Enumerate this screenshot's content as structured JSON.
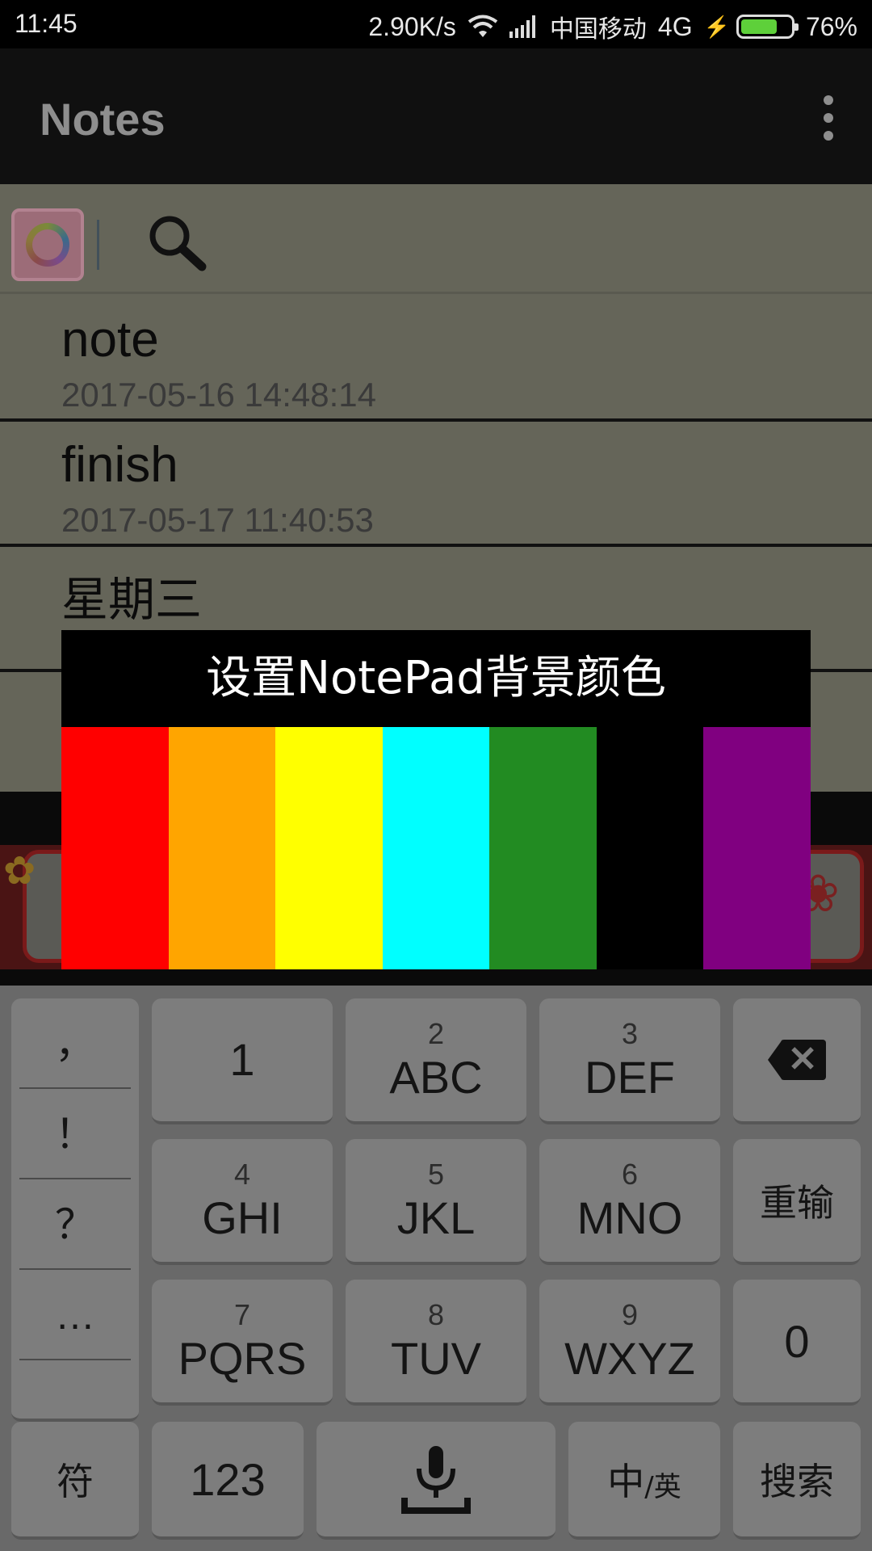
{
  "status_bar": {
    "time": "11:45",
    "net_speed": "2.90K/s",
    "carrier": "中国移动",
    "network": "4G",
    "battery_percent": 76,
    "battery_label": "76%",
    "battery_color": "#5ed03a"
  },
  "action_bar": {
    "title": "Notes",
    "overflow_icon": "more-vertical-icon"
  },
  "search": {
    "app_icon": "color-ring-icon",
    "search_icon": "magnifier-icon",
    "placeholder": ""
  },
  "notes": [
    {
      "title": "note",
      "date": "2017-05-16 14:48:14"
    },
    {
      "title": "finish",
      "date": "2017-05-17 11:40:53"
    },
    {
      "title": "星期三",
      "date": ""
    }
  ],
  "dialog": {
    "title": "设置NotePad背景颜色",
    "colors": [
      {
        "name": "red",
        "hex": "#ff0000"
      },
      {
        "name": "orange",
        "hex": "#ffa500"
      },
      {
        "name": "yellow",
        "hex": "#ffff00"
      },
      {
        "name": "cyan",
        "hex": "#00ffff"
      },
      {
        "name": "green",
        "hex": "#228b22"
      },
      {
        "name": "black",
        "hex": "#000000"
      },
      {
        "name": "purple",
        "hex": "#800080"
      }
    ]
  },
  "keyboard": {
    "punctuation": [
      "，",
      "！",
      "？",
      "…"
    ],
    "row1": [
      {
        "num": "",
        "letters": "1"
      },
      {
        "num": "2",
        "letters": "ABC"
      },
      {
        "num": "3",
        "letters": "DEF"
      }
    ],
    "row2": [
      {
        "num": "4",
        "letters": "GHI"
      },
      {
        "num": "5",
        "letters": "JKL"
      },
      {
        "num": "6",
        "letters": "MNO"
      }
    ],
    "row3": [
      {
        "num": "7",
        "letters": "PQRS"
      },
      {
        "num": "8",
        "letters": "TUV"
      },
      {
        "num": "9",
        "letters": "WXYZ"
      }
    ],
    "backspace_icon": "backspace-icon",
    "retype": "重输",
    "zero": "0",
    "symbols": "符",
    "numbers": "123",
    "mic_icon": "microphone-icon",
    "lang_main": "中",
    "lang_alt": "/英",
    "search": "搜索"
  }
}
